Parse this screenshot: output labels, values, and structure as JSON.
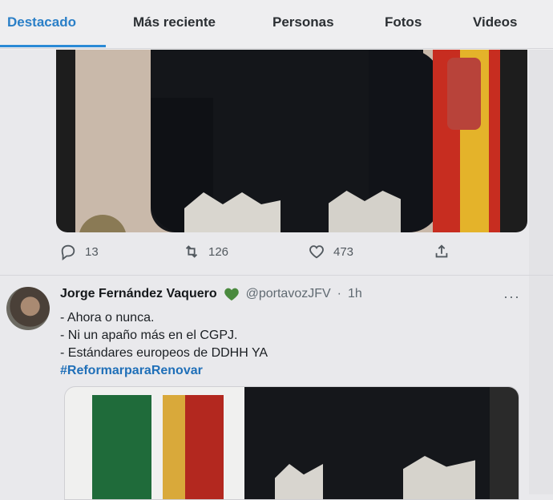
{
  "tabs": [
    {
      "label": "Destacado",
      "active": true
    },
    {
      "label": "Más reciente",
      "active": false
    },
    {
      "label": "Personas",
      "active": false
    },
    {
      "label": "Fotos",
      "active": false
    },
    {
      "label": "Videos",
      "active": false
    }
  ],
  "tweet1_actions": {
    "reply_count": "13",
    "retweet_count": "126",
    "like_count": "473"
  },
  "tweet2": {
    "name": "Jorge Fernández Vaquero",
    "handle": "@portavozJFV",
    "separator": "·",
    "time": "1h",
    "more": "···",
    "lines": [
      "- Ahora o nunca.",
      "- Ni un apaño más en el CGPJ.",
      "- Estándares europeos de DDHH YA"
    ],
    "hashtag": "#ReformarparaRenovar"
  },
  "colors": {
    "accent": "#2a8ad6",
    "heart_green": "#4a8a3e",
    "hashtag": "#1f6fb8"
  },
  "icons": [
    "reply-icon",
    "retweet-icon",
    "like-icon",
    "share-icon",
    "green-heart-icon",
    "more-icon"
  ]
}
